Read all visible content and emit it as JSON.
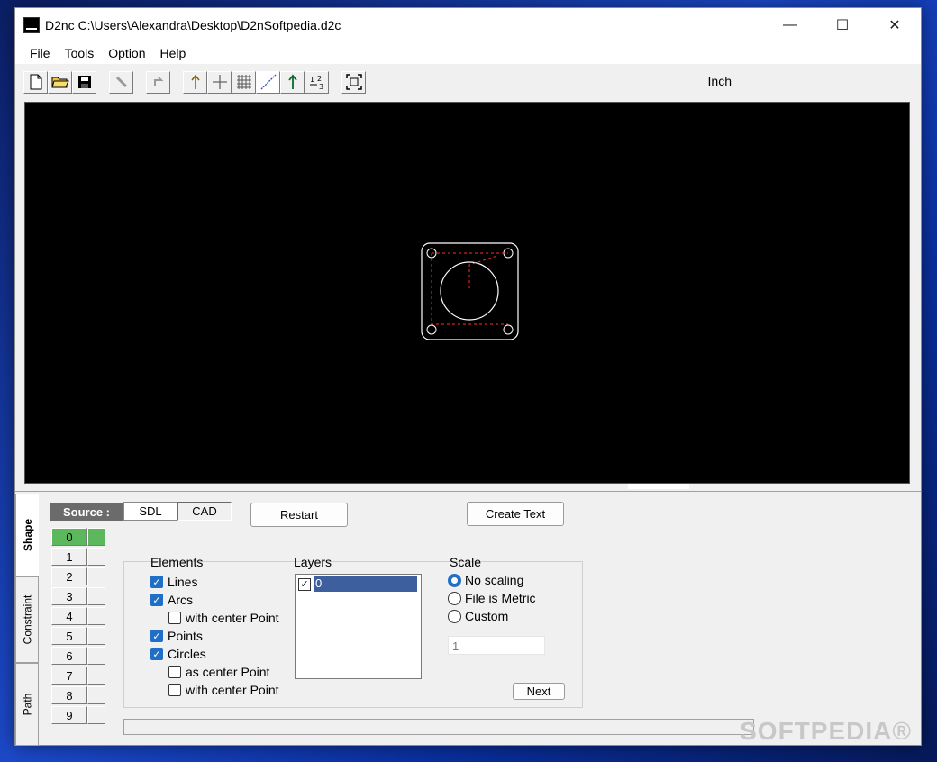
{
  "window": {
    "title": "D2nc C:\\Users\\Alexandra\\Desktop\\D2nSoftpedia.d2c",
    "controls": {
      "minimize": "—",
      "maximize": "☐",
      "close": "✕"
    }
  },
  "menu": [
    "File",
    "Tools",
    "Option",
    "Help"
  ],
  "toolbar": {
    "icons": [
      "new-file-icon",
      "open-folder-icon",
      "save-icon",
      "wand-icon",
      "undo-icon",
      "arrow-up-icon",
      "crosshair-icon",
      "grid-icon",
      "diagonal-line-icon",
      "green-arrow-icon",
      "numbering-icon",
      "fit-view-icon"
    ],
    "units_label": "Inch"
  },
  "tabs": [
    "Shape",
    "Constraint",
    "Path"
  ],
  "source": {
    "label": "Source :",
    "options": [
      "SDL",
      "CAD"
    ],
    "selected": "CAD"
  },
  "buttons": {
    "restart": "Restart",
    "create_text": "Create Text",
    "next": "Next"
  },
  "layer_numbers": [
    "0",
    "1",
    "2",
    "3",
    "4",
    "5",
    "6",
    "7",
    "8",
    "9"
  ],
  "elements": {
    "title": "Elements",
    "lines": "Lines",
    "arcs": "Arcs",
    "arcs_center": "with center Point",
    "points": "Points",
    "circles": "Circles",
    "circles_as_center": "as center Point",
    "circles_center": "with center Point"
  },
  "layers": {
    "title": "Layers",
    "items": [
      "0"
    ]
  },
  "scale": {
    "title": "Scale",
    "options": [
      "No scaling",
      "File is Metric",
      "Custom"
    ],
    "selected": "No scaling",
    "custom_value": "1"
  },
  "watermark": "SOFTPEDIA®",
  "colors": {
    "accent": "#1f6fc9",
    "active_layer": "#5cb85c",
    "canvas": "#000000",
    "dashed": "#ff2a2a"
  }
}
